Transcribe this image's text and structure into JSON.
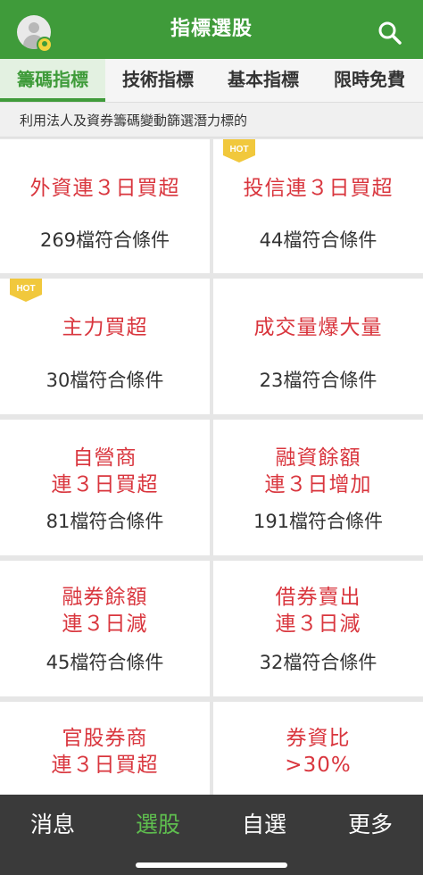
{
  "header": {
    "title": "指標選股"
  },
  "tabs": [
    {
      "label": "籌碼指標"
    },
    {
      "label": "技術指標"
    },
    {
      "label": "基本指標"
    },
    {
      "label": "限時免費"
    }
  ],
  "subtitle": "利用法人及資券籌碼變動篩選潛力標的",
  "badge": "HOT",
  "cards": [
    {
      "title": "外資連３日買超",
      "count": "269檔符合條件"
    },
    {
      "title": "投信連３日買超",
      "count": "44檔符合條件"
    },
    {
      "title": "主力買超",
      "count": "30檔符合條件"
    },
    {
      "title": "成交量爆大量",
      "count": "23檔符合條件"
    },
    {
      "title_line1": "自營商",
      "title_line2": "連３日買超",
      "count": "81檔符合條件"
    },
    {
      "title_line1": "融資餘額",
      "title_line2": "連３日增加",
      "count": "191檔符合條件"
    },
    {
      "title_line1": "融券餘額",
      "title_line2": "連３日減",
      "count": "45檔符合條件"
    },
    {
      "title_line1": "借券賣出",
      "title_line2": "連３日減",
      "count": "32檔符合條件"
    },
    {
      "title_line1": "官股券商",
      "title_line2": "連３日買超"
    },
    {
      "title_line1": "券資比",
      "title_line2": ">30%"
    }
  ],
  "tabbar": [
    {
      "label": "消息"
    },
    {
      "label": "選股"
    },
    {
      "label": "自選"
    },
    {
      "label": "更多"
    }
  ],
  "colors": {
    "brand_green": "#3f9b3a",
    "title_red": "#d9363e",
    "hot_yellow": "#f1c83c",
    "tabbar_bg": "#3a3a3a"
  }
}
